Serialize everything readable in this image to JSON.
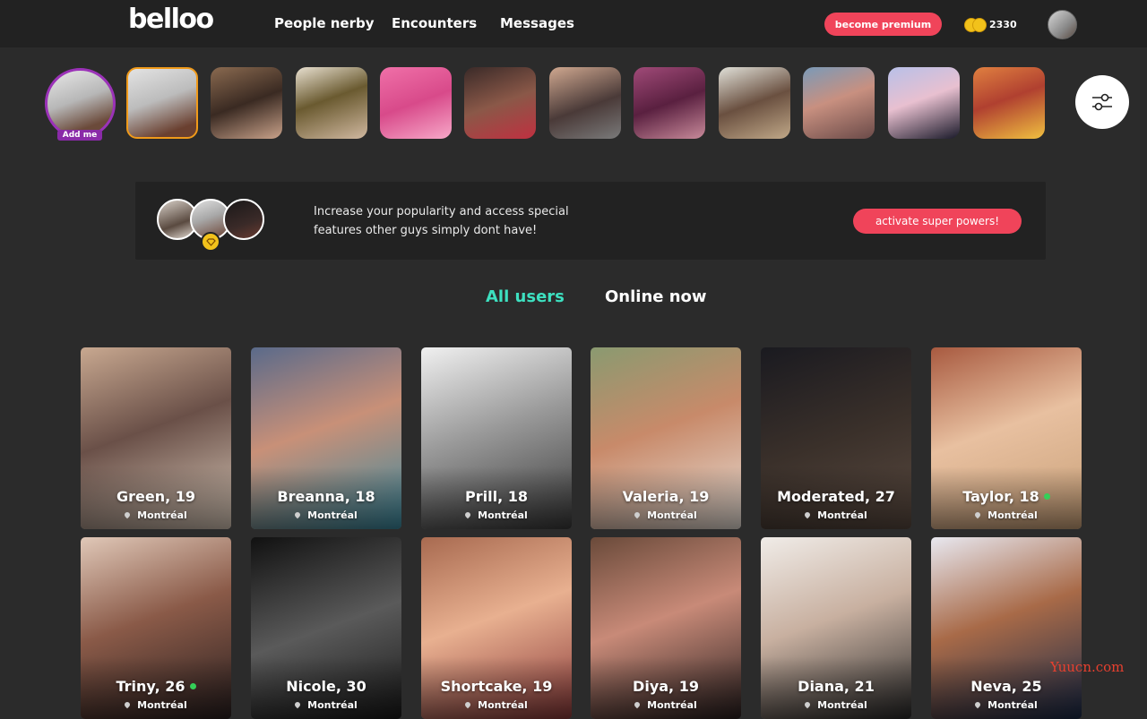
{
  "header": {
    "logo": "belloo",
    "nav": [
      "People nerby",
      "Encounters",
      "Messages"
    ],
    "premium_label": "become premium",
    "coin_count": "2330"
  },
  "stories": {
    "add_me_label": "Add me"
  },
  "promo": {
    "text": "Increase your popularity and access special features other guys simply dont have!",
    "button_label": "activate super powers!"
  },
  "tabs": {
    "all": "All users",
    "online": "Online now"
  },
  "users": [
    {
      "name": "Green, 19",
      "location": "Montréal",
      "online": false
    },
    {
      "name": "Breanna, 18",
      "location": "Montréal",
      "online": false
    },
    {
      "name": "Prill, 18",
      "location": "Montréal",
      "online": false
    },
    {
      "name": "Valeria, 19",
      "location": "Montréal",
      "online": false
    },
    {
      "name": "Moderated, 27",
      "location": "Montréal",
      "online": false
    },
    {
      "name": "Taylor, 18",
      "location": "Montréal",
      "online": true
    },
    {
      "name": "Triny, 26",
      "location": "Montréal",
      "online": true
    },
    {
      "name": "Nicole, 30",
      "location": "Montréal",
      "online": false
    },
    {
      "name": "Shortcake, 19",
      "location": "Montréal",
      "online": false
    },
    {
      "name": "Diya, 19",
      "location": "Montréal",
      "online": false
    },
    {
      "name": "Diana, 21",
      "location": "Montréal",
      "online": false
    },
    {
      "name": "Neva, 25",
      "location": "Montréal",
      "online": false
    }
  ],
  "watermark": "Yuucn.com",
  "colors": {
    "accent_pink": "#f0445a",
    "accent_teal": "#3de0c0",
    "online_green": "#34d058",
    "coin_gold": "#f2c21b"
  }
}
